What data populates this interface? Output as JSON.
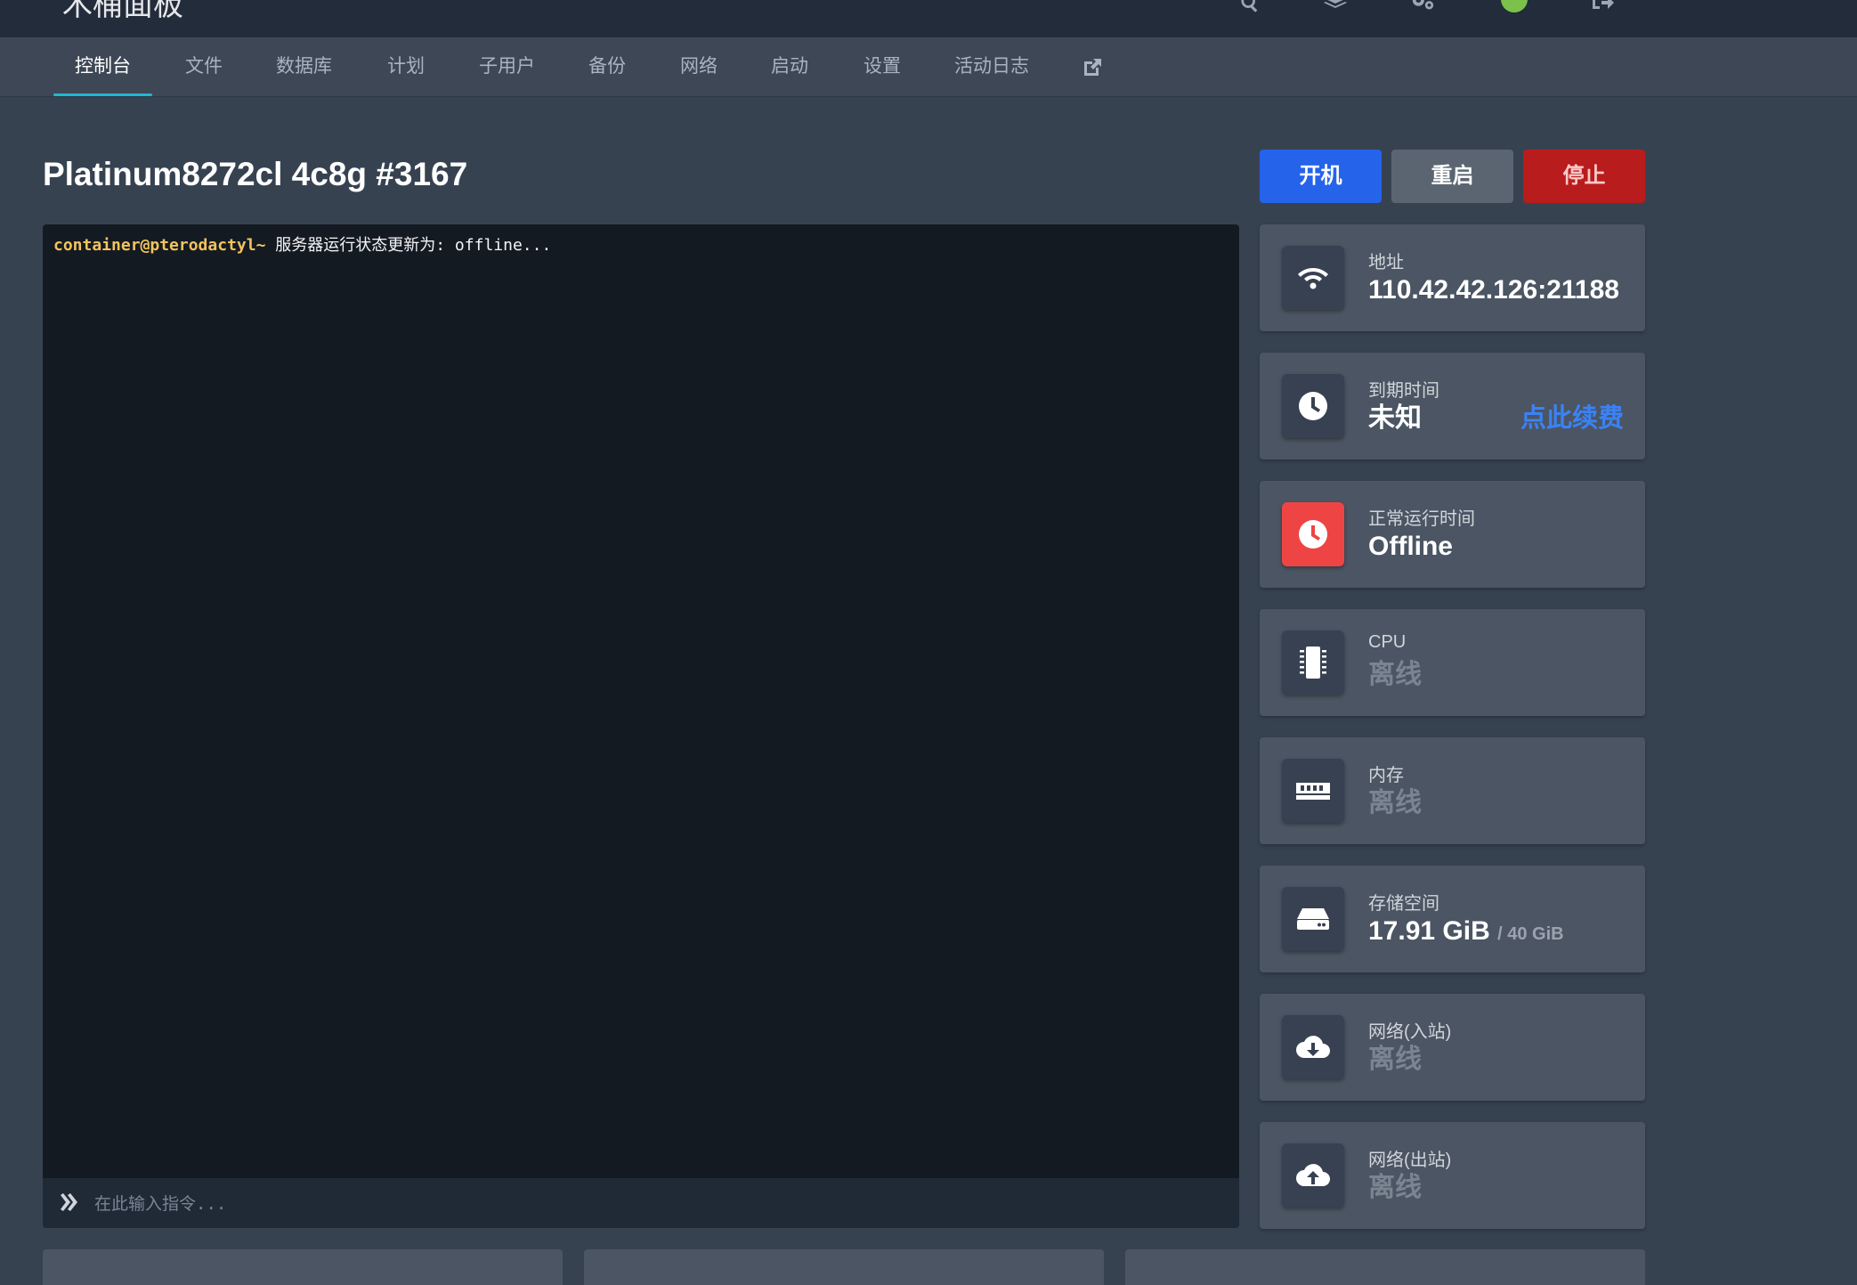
{
  "header": {
    "brand": "木桶面板",
    "icons": [
      "search-icon",
      "layers-icon",
      "cogs-icon",
      "status-dot",
      "logout-icon"
    ]
  },
  "nav": {
    "tabs": [
      {
        "label": "控制台",
        "active": true
      },
      {
        "label": "文件"
      },
      {
        "label": "数据库"
      },
      {
        "label": "计划"
      },
      {
        "label": "子用户"
      },
      {
        "label": "备份"
      },
      {
        "label": "网络"
      },
      {
        "label": "启动"
      },
      {
        "label": "设置"
      },
      {
        "label": "活动日志"
      }
    ],
    "external_icon": "external-link-icon"
  },
  "server": {
    "title": "Platinum8272cl 4c8g #3167"
  },
  "power": {
    "start": "开机",
    "restart": "重启",
    "stop": "停止"
  },
  "console": {
    "prompt": "container@pterodactyl~",
    "message": " 服务器运行状态更新为: offline...",
    "input_placeholder": "在此输入指令..."
  },
  "stats": {
    "address": {
      "label": "地址",
      "value": "110.42.42.126:21188",
      "icon": "wifi-icon"
    },
    "expiry": {
      "label": "到期时间",
      "value": "未知",
      "link": "点此续费",
      "icon": "clock-icon"
    },
    "uptime": {
      "label": "正常运行时间",
      "value": "Offline",
      "icon": "clock-icon"
    },
    "cpu": {
      "label": "CPU",
      "value": "离线",
      "icon": "microchip-icon"
    },
    "memory": {
      "label": "内存",
      "value": "离线",
      "icon": "memory-icon"
    },
    "storage": {
      "label": "存储空间",
      "value": "17.91 GiB",
      "limit": "/ 40 GiB",
      "icon": "hdd-icon"
    },
    "net_in": {
      "label": "网络(入站)",
      "value": "离线",
      "icon": "cloud-download-icon"
    },
    "net_out": {
      "label": "网络(出站)",
      "value": "离线",
      "icon": "cloud-upload-icon"
    }
  },
  "colors": {
    "accent": "#22b8cf",
    "start": "#2563eb",
    "restart": "#5b6572",
    "stop": "#b91c1c",
    "uptime_icon_bg": "#ef4444",
    "renew_link": "#3b82f6",
    "status_dot": "#7cc14a"
  }
}
